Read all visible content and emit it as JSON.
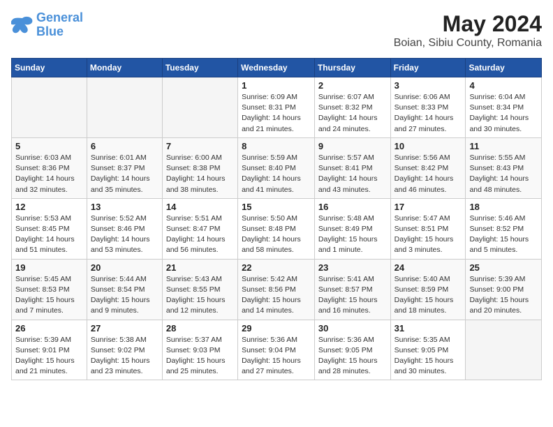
{
  "header": {
    "logo_line1": "General",
    "logo_line2": "Blue",
    "month_year": "May 2024",
    "location": "Boian, Sibiu County, Romania"
  },
  "days_of_week": [
    "Sunday",
    "Monday",
    "Tuesday",
    "Wednesday",
    "Thursday",
    "Friday",
    "Saturday"
  ],
  "weeks": [
    [
      {
        "day": "",
        "info": ""
      },
      {
        "day": "",
        "info": ""
      },
      {
        "day": "",
        "info": ""
      },
      {
        "day": "1",
        "info": "Sunrise: 6:09 AM\nSunset: 8:31 PM\nDaylight: 14 hours\nand 21 minutes."
      },
      {
        "day": "2",
        "info": "Sunrise: 6:07 AM\nSunset: 8:32 PM\nDaylight: 14 hours\nand 24 minutes."
      },
      {
        "day": "3",
        "info": "Sunrise: 6:06 AM\nSunset: 8:33 PM\nDaylight: 14 hours\nand 27 minutes."
      },
      {
        "day": "4",
        "info": "Sunrise: 6:04 AM\nSunset: 8:34 PM\nDaylight: 14 hours\nand 30 minutes."
      }
    ],
    [
      {
        "day": "5",
        "info": "Sunrise: 6:03 AM\nSunset: 8:36 PM\nDaylight: 14 hours\nand 32 minutes."
      },
      {
        "day": "6",
        "info": "Sunrise: 6:01 AM\nSunset: 8:37 PM\nDaylight: 14 hours\nand 35 minutes."
      },
      {
        "day": "7",
        "info": "Sunrise: 6:00 AM\nSunset: 8:38 PM\nDaylight: 14 hours\nand 38 minutes."
      },
      {
        "day": "8",
        "info": "Sunrise: 5:59 AM\nSunset: 8:40 PM\nDaylight: 14 hours\nand 41 minutes."
      },
      {
        "day": "9",
        "info": "Sunrise: 5:57 AM\nSunset: 8:41 PM\nDaylight: 14 hours\nand 43 minutes."
      },
      {
        "day": "10",
        "info": "Sunrise: 5:56 AM\nSunset: 8:42 PM\nDaylight: 14 hours\nand 46 minutes."
      },
      {
        "day": "11",
        "info": "Sunrise: 5:55 AM\nSunset: 8:43 PM\nDaylight: 14 hours\nand 48 minutes."
      }
    ],
    [
      {
        "day": "12",
        "info": "Sunrise: 5:53 AM\nSunset: 8:45 PM\nDaylight: 14 hours\nand 51 minutes."
      },
      {
        "day": "13",
        "info": "Sunrise: 5:52 AM\nSunset: 8:46 PM\nDaylight: 14 hours\nand 53 minutes."
      },
      {
        "day": "14",
        "info": "Sunrise: 5:51 AM\nSunset: 8:47 PM\nDaylight: 14 hours\nand 56 minutes."
      },
      {
        "day": "15",
        "info": "Sunrise: 5:50 AM\nSunset: 8:48 PM\nDaylight: 14 hours\nand 58 minutes."
      },
      {
        "day": "16",
        "info": "Sunrise: 5:48 AM\nSunset: 8:49 PM\nDaylight: 15 hours\nand 1 minute."
      },
      {
        "day": "17",
        "info": "Sunrise: 5:47 AM\nSunset: 8:51 PM\nDaylight: 15 hours\nand 3 minutes."
      },
      {
        "day": "18",
        "info": "Sunrise: 5:46 AM\nSunset: 8:52 PM\nDaylight: 15 hours\nand 5 minutes."
      }
    ],
    [
      {
        "day": "19",
        "info": "Sunrise: 5:45 AM\nSunset: 8:53 PM\nDaylight: 15 hours\nand 7 minutes."
      },
      {
        "day": "20",
        "info": "Sunrise: 5:44 AM\nSunset: 8:54 PM\nDaylight: 15 hours\nand 9 minutes."
      },
      {
        "day": "21",
        "info": "Sunrise: 5:43 AM\nSunset: 8:55 PM\nDaylight: 15 hours\nand 12 minutes."
      },
      {
        "day": "22",
        "info": "Sunrise: 5:42 AM\nSunset: 8:56 PM\nDaylight: 15 hours\nand 14 minutes."
      },
      {
        "day": "23",
        "info": "Sunrise: 5:41 AM\nSunset: 8:57 PM\nDaylight: 15 hours\nand 16 minutes."
      },
      {
        "day": "24",
        "info": "Sunrise: 5:40 AM\nSunset: 8:59 PM\nDaylight: 15 hours\nand 18 minutes."
      },
      {
        "day": "25",
        "info": "Sunrise: 5:39 AM\nSunset: 9:00 PM\nDaylight: 15 hours\nand 20 minutes."
      }
    ],
    [
      {
        "day": "26",
        "info": "Sunrise: 5:39 AM\nSunset: 9:01 PM\nDaylight: 15 hours\nand 21 minutes."
      },
      {
        "day": "27",
        "info": "Sunrise: 5:38 AM\nSunset: 9:02 PM\nDaylight: 15 hours\nand 23 minutes."
      },
      {
        "day": "28",
        "info": "Sunrise: 5:37 AM\nSunset: 9:03 PM\nDaylight: 15 hours\nand 25 minutes."
      },
      {
        "day": "29",
        "info": "Sunrise: 5:36 AM\nSunset: 9:04 PM\nDaylight: 15 hours\nand 27 minutes."
      },
      {
        "day": "30",
        "info": "Sunrise: 5:36 AM\nSunset: 9:05 PM\nDaylight: 15 hours\nand 28 minutes."
      },
      {
        "day": "31",
        "info": "Sunrise: 5:35 AM\nSunset: 9:05 PM\nDaylight: 15 hours\nand 30 minutes."
      },
      {
        "day": "",
        "info": ""
      }
    ]
  ]
}
